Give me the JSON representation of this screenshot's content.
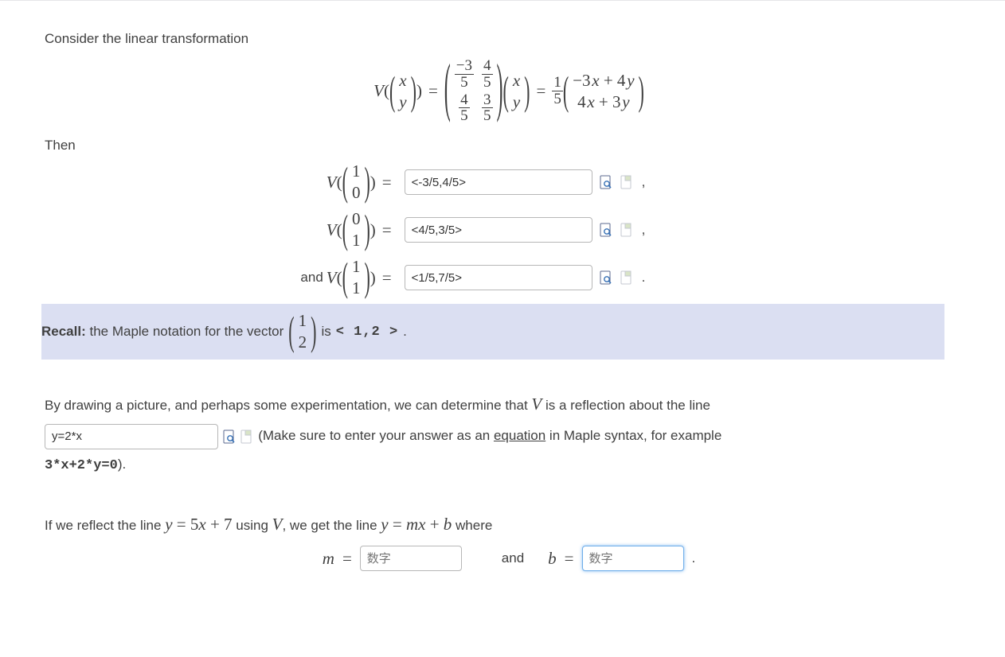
{
  "intro": "Consider the linear transformation",
  "then": "Then",
  "matrix_def": {
    "a11_num": "−3",
    "a11_den": "5",
    "a12_num": "4",
    "a12_den": "5",
    "a21_num": "4",
    "a21_den": "5",
    "a22_num": "3",
    "a22_den": "5",
    "scalar_num": "1",
    "scalar_den": "5",
    "result_top": "−3 x + 4 y",
    "result_bot": "4 x + 3 y"
  },
  "answers": {
    "v10_lhs_top": "1",
    "v10_lhs_bot": "0",
    "v10_value": "<-3/5,4/5>",
    "v01_lhs_top": "0",
    "v01_lhs_bot": "1",
    "v01_value": "<4/5,3/5>",
    "v11_lhs_top": "1",
    "v11_lhs_bot": "1",
    "v11_value": "<1/5,7/5>",
    "and": "and"
  },
  "recall": {
    "label": "Recall:",
    "text_before": " the Maple notation for the vector ",
    "vec_top": "1",
    "vec_bot": "2",
    "text_after": " is ",
    "code": "< 1,2 >",
    "period": "."
  },
  "reflect_line": {
    "text_a": "By drawing a picture, and perhaps some experimentation, we can determine that ",
    "text_b": " is a reflection about the line",
    "input_value": "y=2*x",
    "hint_a": " (Make sure to enter your answer as an ",
    "hint_eq": "equation",
    "hint_b": " in Maple syntax, for example ",
    "example": "3*x+2*y=0",
    "close": ")."
  },
  "reflect_result": {
    "text": "If we reflect the line ",
    "eq1": "y = 5x + 7",
    "mid": " using ",
    "mid2": ", we get the line ",
    "eq2": "y = mx + b",
    "where": " where",
    "m_label": "m =",
    "m_placeholder": "数字",
    "and": "and",
    "b_label": "b =",
    "b_placeholder": "数字",
    "period": "."
  }
}
